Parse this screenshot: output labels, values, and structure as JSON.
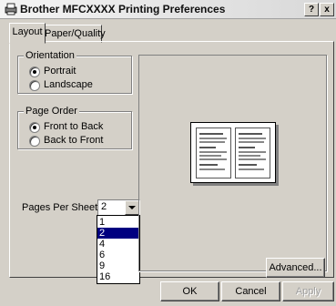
{
  "window": {
    "title": "Brother MFCXXXX Printing Preferences",
    "help_button": "?",
    "close_button": "x"
  },
  "tabs": [
    {
      "label": "Layout",
      "active": true
    },
    {
      "label": "Paper/Quality",
      "active": false
    }
  ],
  "orientation": {
    "legend": "Orientation",
    "options": [
      {
        "label": "Portrait",
        "selected": true
      },
      {
        "label": "Landscape",
        "selected": false
      }
    ]
  },
  "page_order": {
    "legend": "Page Order",
    "options": [
      {
        "label": "Front to Back",
        "selected": true
      },
      {
        "label": "Back to Front",
        "selected": false
      }
    ]
  },
  "pages_per_sheet": {
    "label": "Pages Per Sheet:",
    "value": "2",
    "options": [
      "1",
      "2",
      "4",
      "6",
      "9",
      "16"
    ],
    "highlighted": "2"
  },
  "buttons": {
    "advanced": "Advanced...",
    "ok": "OK",
    "cancel": "Cancel",
    "apply": "Apply"
  }
}
